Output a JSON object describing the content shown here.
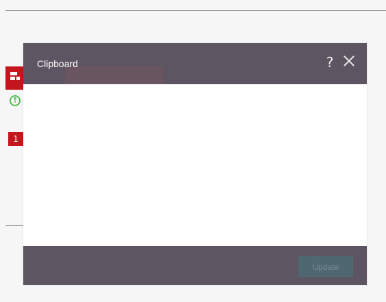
{
  "background_widgets": {
    "badge_count": "1",
    "icons": {
      "widget": "widget-layout-icon",
      "upload": "upload-circle-icon"
    },
    "colors": {
      "brand_red": "#c4161c",
      "success_green": "#4fbd4f"
    }
  },
  "modal": {
    "title": "Clipboard",
    "help_label": "?",
    "close_icon": "close-icon",
    "update_label": "Update",
    "colors": {
      "header_bg": "#5d5561",
      "body_bg": "#ffffff",
      "update_bg": "#4e6771"
    }
  }
}
